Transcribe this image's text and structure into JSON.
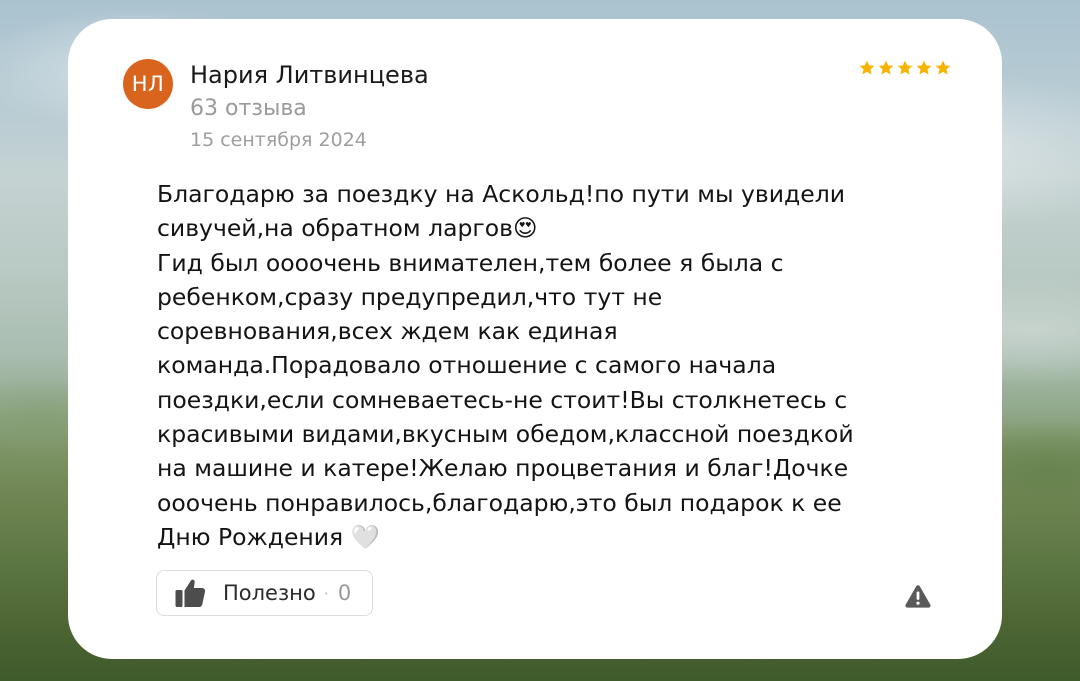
{
  "review": {
    "author": {
      "initials": "НЛ",
      "name": "Нария Литвинцева",
      "reviews_count": "63 отзыва"
    },
    "date": "15 сентября 2024",
    "rating": 5,
    "text": "Благодарю за поездку на Аскольд!по пути мы увидели\nсивучей,на обратном ларгов😍\nГид был оооочень внимателен,тем более я была с\nребенком,сразу предупредил,что тут не\nсоревнования,всех ждем как единая\nкоманда.Порадовало отношение с самого начала\nпоездки,если сомневаетесь-не стоит!Вы столкнетесь с\nкрасивыми видами,вкусным обедом,классной поездкой\nна машине и катере!Желаю процветания и благ!Дочке\nооочень понравилось,благодарю,это был подарок к ее\nДню Рождения 🤍",
    "actions": {
      "helpful_label": "Полезно",
      "helpful_separator": "·",
      "helpful_count": "0",
      "helpful_icon": "thumbs-up-icon",
      "report_icon": "warning-icon"
    }
  },
  "colors": {
    "avatar_background": "#d9641e",
    "star": "#f6b400",
    "card_background": "#ffffff"
  }
}
